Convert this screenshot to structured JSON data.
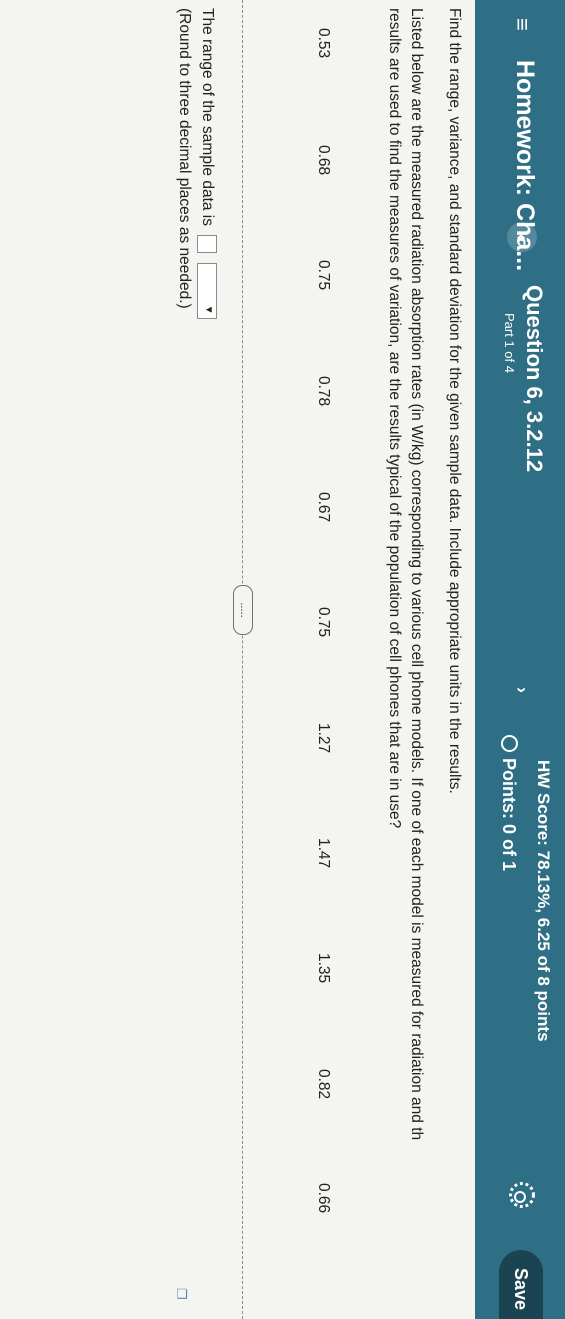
{
  "header": {
    "menu_icon": "menu-icon",
    "title": "Homework: Cha...",
    "question_title": "Question 6, 3.2.12",
    "question_part": "Part 1 of 4",
    "hw_score": "HW Score: 78.13%, 6.25 of 8 points",
    "points": "Points: 0 of 1",
    "save_label": "Save",
    "accent_color": "#2e6f86"
  },
  "question": {
    "instruction": "Find the range, variance, and standard deviation for the given sample data. Include appropriate units in the results.",
    "body_line1": "Listed below are the measured radiation absorption rates (in W/kg) corresponding to various cell phone models. If one of each model is measured for radiation and th",
    "body_line2": "results are used to find the measures of variation, are the results typical of the population of cell phones that are in use?",
    "data_values": [
      "0.53",
      "0.68",
      "0.75",
      "0.78",
      "0.67",
      "0.75",
      "1.27",
      "1.47",
      "1.35",
      "0.82",
      "0.66"
    ],
    "expand_label": "....."
  },
  "answer": {
    "prompt": "The range of the sample data is",
    "note": "(Round to three decimal places as needed.)"
  }
}
